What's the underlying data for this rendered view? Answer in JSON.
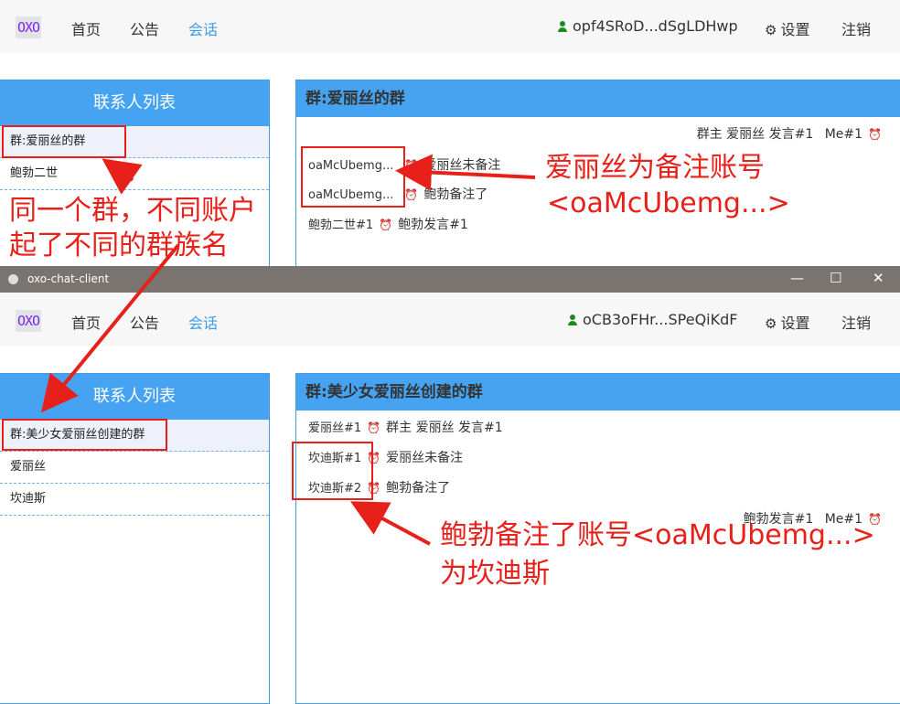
{
  "top": {
    "nav": {
      "logo": "OXO",
      "home": "首页",
      "announce": "公告",
      "chat": "会话",
      "user": "opf4SRoD...dSgLDHwp",
      "settings": "设置",
      "logout": "注销"
    },
    "contacts_title": "联系人列表",
    "contacts": [
      "群:爱丽丝的群",
      "鲍勃二世"
    ],
    "chat_title": "群:爱丽丝的群",
    "messages": [
      {
        "sender": "",
        "text": "群主 爱丽丝 发言#1",
        "me": "Me#1"
      },
      {
        "sender": "oaMcUbemg...",
        "text": "爱丽丝未备注"
      },
      {
        "sender": "oaMcUbemg...",
        "text": "鲍勃备注了"
      },
      {
        "sender": "鲍勃二世#1",
        "text": "鲍勃发言#1"
      }
    ]
  },
  "window": {
    "title": "oxo-chat-client",
    "minimize": "—",
    "maximize": "☐",
    "close": "✕"
  },
  "bottom": {
    "nav": {
      "logo": "OXO",
      "home": "首页",
      "announce": "公告",
      "chat": "会话",
      "user": "oCB3oFHr...SPeQiKdF",
      "settings": "设置",
      "logout": "注销"
    },
    "contacts_title": "联系人列表",
    "contacts": [
      "群:美少女爱丽丝创建的群",
      "爱丽丝",
      "坎迪斯"
    ],
    "chat_title": "群:美少女爱丽丝创建的群",
    "messages": [
      {
        "sender": "爱丽丝#1",
        "text": "群主 爱丽丝 发言#1"
      },
      {
        "sender": "坎迪斯#1",
        "text": "爱丽丝未备注"
      },
      {
        "sender": "坎迪斯#2",
        "text": "鲍勃备注了"
      },
      {
        "sender": "",
        "text": "鲍勃发言#1",
        "me": "Me#1"
      }
    ]
  },
  "annotations": {
    "left_note_1": "同一个群，不同账户",
    "left_note_2": "起了不同的群族名",
    "right_note_1": "爱丽丝为备注账号",
    "right_note_2": "<oaMcUbemg...>",
    "bottom_note_1": "鲍勃备注了账号<oaMcUbemg...>",
    "bottom_note_2": "为坎迪斯"
  },
  "icons": {
    "user": "user-icon",
    "settings": "gear-icon",
    "clock": "alarm-clock-icon"
  },
  "colors": {
    "accent": "#45a3f2",
    "annotation": "#e8201a",
    "active_nav": "#3d9be9"
  }
}
